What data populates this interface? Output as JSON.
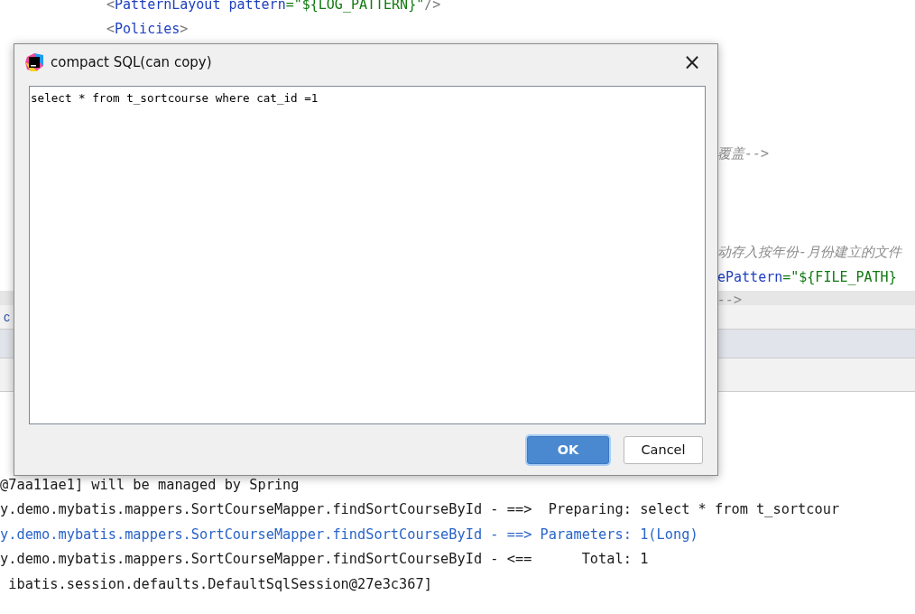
{
  "editor": {
    "lines": [
      {
        "kind": "tag",
        "segments": [
          {
            "kind": "punct",
            "text": "<"
          },
          {
            "kind": "tag",
            "text": "PatternLayout "
          },
          {
            "kind": "attr",
            "text": "pattern"
          },
          {
            "kind": "value",
            "text": "=\"${LOG_PATTERN}\""
          },
          {
            "kind": "punct",
            "text": "/>"
          }
        ]
      },
      {
        "kind": "tag",
        "segments": [
          {
            "kind": "punct",
            "text": "<"
          },
          {
            "kind": "tag",
            "text": "Policies"
          },
          {
            "kind": "punct",
            "text": ">"
          }
        ]
      },
      {
        "kind": "cut",
        "segments": [
          {
            "kind": "comment",
            "text": "覆盖-->"
          }
        ]
      },
      {
        "kind": "cut",
        "segments": [
          {
            "kind": "comment",
            "text": "动存入按年份-月份建立的文件"
          }
        ]
      },
      {
        "kind": "cut",
        "segments": [
          {
            "kind": "attr",
            "text": "ePattern"
          },
          {
            "kind": "value",
            "text": "=\"${FILE_PATH}"
          }
        ]
      },
      {
        "kind": "cut",
        "segments": [
          {
            "kind": "comment",
            "text": "-->"
          }
        ]
      }
    ]
  },
  "tool_window": {
    "tab": "c"
  },
  "console": {
    "lines": [
      {
        "kind": "plain",
        "text": "@7aa11ae1] will be managed by Spring"
      },
      {
        "kind": "plain",
        "text": "y.demo.mybatis.mappers.SortCourseMapper.findSortCourseById - ==>  Preparing: select * from t_sortcour"
      },
      {
        "kind": "link",
        "text": "y.demo.mybatis.mappers.SortCourseMapper.findSortCourseById - ==> Parameters: 1(Long)"
      },
      {
        "kind": "plain",
        "text": "y.demo.mybatis.mappers.SortCourseMapper.findSortCourseById - <==      Total: 1"
      },
      {
        "kind": "plain",
        "text": " ibatis.session.defaults.DefaultSqlSession@27e3c367]"
      }
    ]
  },
  "dialog": {
    "title": "compact SQL(can copy)",
    "close": "×",
    "sql": "select * from t_sortcourse where cat_id =1",
    "buttons": [
      {
        "label": "OK",
        "kind": "primary"
      },
      {
        "label": "Cancel",
        "kind": "secondary"
      }
    ]
  }
}
